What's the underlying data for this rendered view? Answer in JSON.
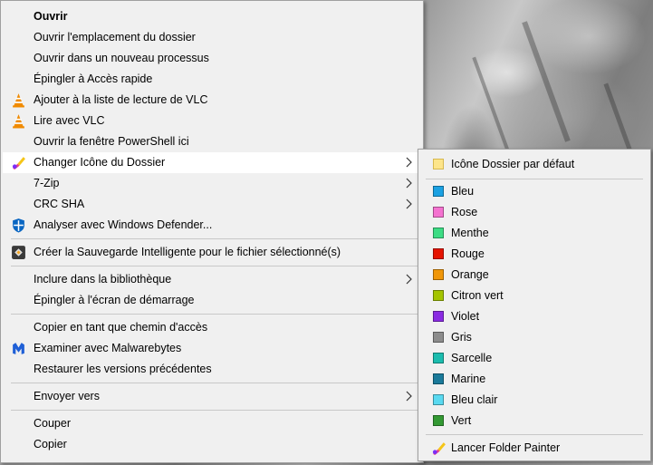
{
  "main_menu": {
    "items": [
      {
        "label": "Ouvrir"
      },
      {
        "label": "Ouvrir l'emplacement du dossier"
      },
      {
        "label": "Ouvrir dans un nouveau processus"
      },
      {
        "label": "Épingler à Accès rapide"
      },
      {
        "label": "Ajouter à la liste de lecture de VLC",
        "icon": "vlc-icon"
      },
      {
        "label": "Lire avec VLC",
        "icon": "vlc-icon"
      },
      {
        "label": "Ouvrir la fenêtre PowerShell ici"
      },
      {
        "label": "Changer Icône du Dossier",
        "icon": "folder-painter-icon"
      },
      {
        "label": "7-Zip"
      },
      {
        "label": "CRC SHA"
      },
      {
        "label": "Analyser avec Windows Defender...",
        "icon": "windows-defender-icon"
      },
      {
        "label": "Créer la Sauvegarde Intelligente pour le fichier sélectionné(s)",
        "icon": "backup-icon"
      },
      {
        "label": "Inclure dans la bibliothèque"
      },
      {
        "label": "Épingler à l'écran de démarrage"
      },
      {
        "label": "Copier en tant que chemin d'accès"
      },
      {
        "label": "Examiner avec Malwarebytes",
        "icon": "malwarebytes-icon"
      },
      {
        "label": "Restaurer les versions précédentes"
      },
      {
        "label": "Envoyer vers"
      },
      {
        "label": "Couper"
      },
      {
        "label": "Copier"
      }
    ]
  },
  "submenu": {
    "default_item": {
      "label": "Icône Dossier par défaut",
      "color": "#fde58a"
    },
    "colors": [
      {
        "label": "Bleu",
        "color": "#1ba1e2"
      },
      {
        "label": "Rose",
        "color": "#f472d0"
      },
      {
        "label": "Menthe",
        "color": "#3ddc84"
      },
      {
        "label": "Rouge",
        "color": "#e51400"
      },
      {
        "label": "Orange",
        "color": "#f09609"
      },
      {
        "label": "Citron vert",
        "color": "#a4c400"
      },
      {
        "label": "Violet",
        "color": "#8a2be2"
      },
      {
        "label": "Gris",
        "color": "#8c8c8c"
      },
      {
        "label": "Sarcelle",
        "color": "#1bbcae"
      },
      {
        "label": "Marine",
        "color": "#1a7a9a"
      },
      {
        "label": "Bleu clair",
        "color": "#59d9f0"
      },
      {
        "label": "Vert",
        "color": "#339933"
      }
    ],
    "launch_item": {
      "label": "Lancer Folder Painter",
      "icon": "folder-painter-icon"
    }
  }
}
